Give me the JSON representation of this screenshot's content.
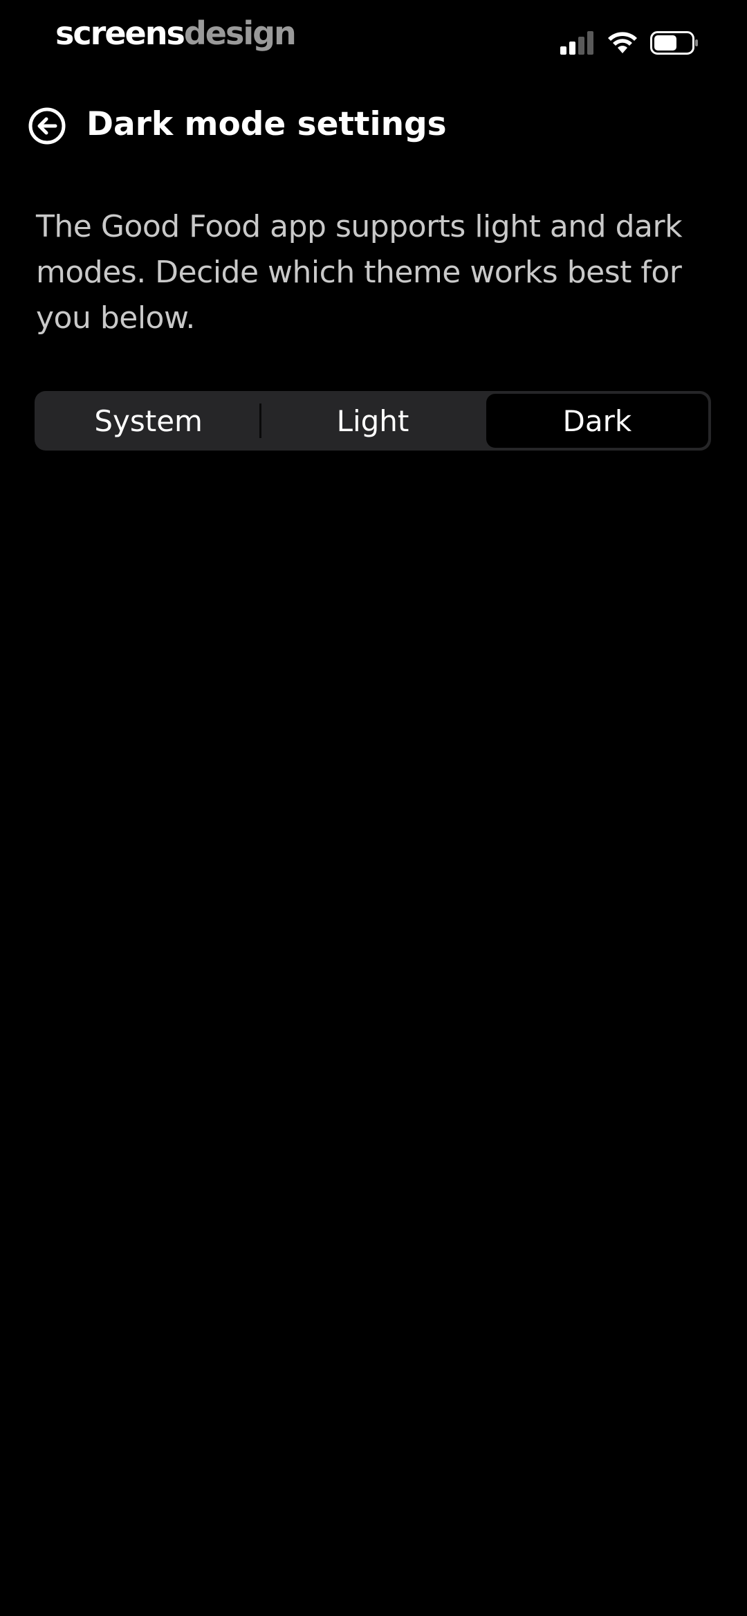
{
  "status_bar": {
    "brand_part_a": "screens",
    "brand_part_b": "design",
    "icons": [
      "signal-icon",
      "wifi-icon",
      "battery-icon"
    ]
  },
  "header": {
    "back_icon": "back-arrow-circle-icon",
    "title": "Dark mode settings"
  },
  "description": "The Good Food app supports light and dark modes. Decide which theme works best for you below.",
  "theme_selector": {
    "options": [
      "System",
      "Light",
      "Dark"
    ],
    "selected": "Dark"
  },
  "colors": {
    "background": "#000000",
    "segment_track": "#262628",
    "segment_selected": "#000000",
    "description_text": "#c9c9c9"
  }
}
